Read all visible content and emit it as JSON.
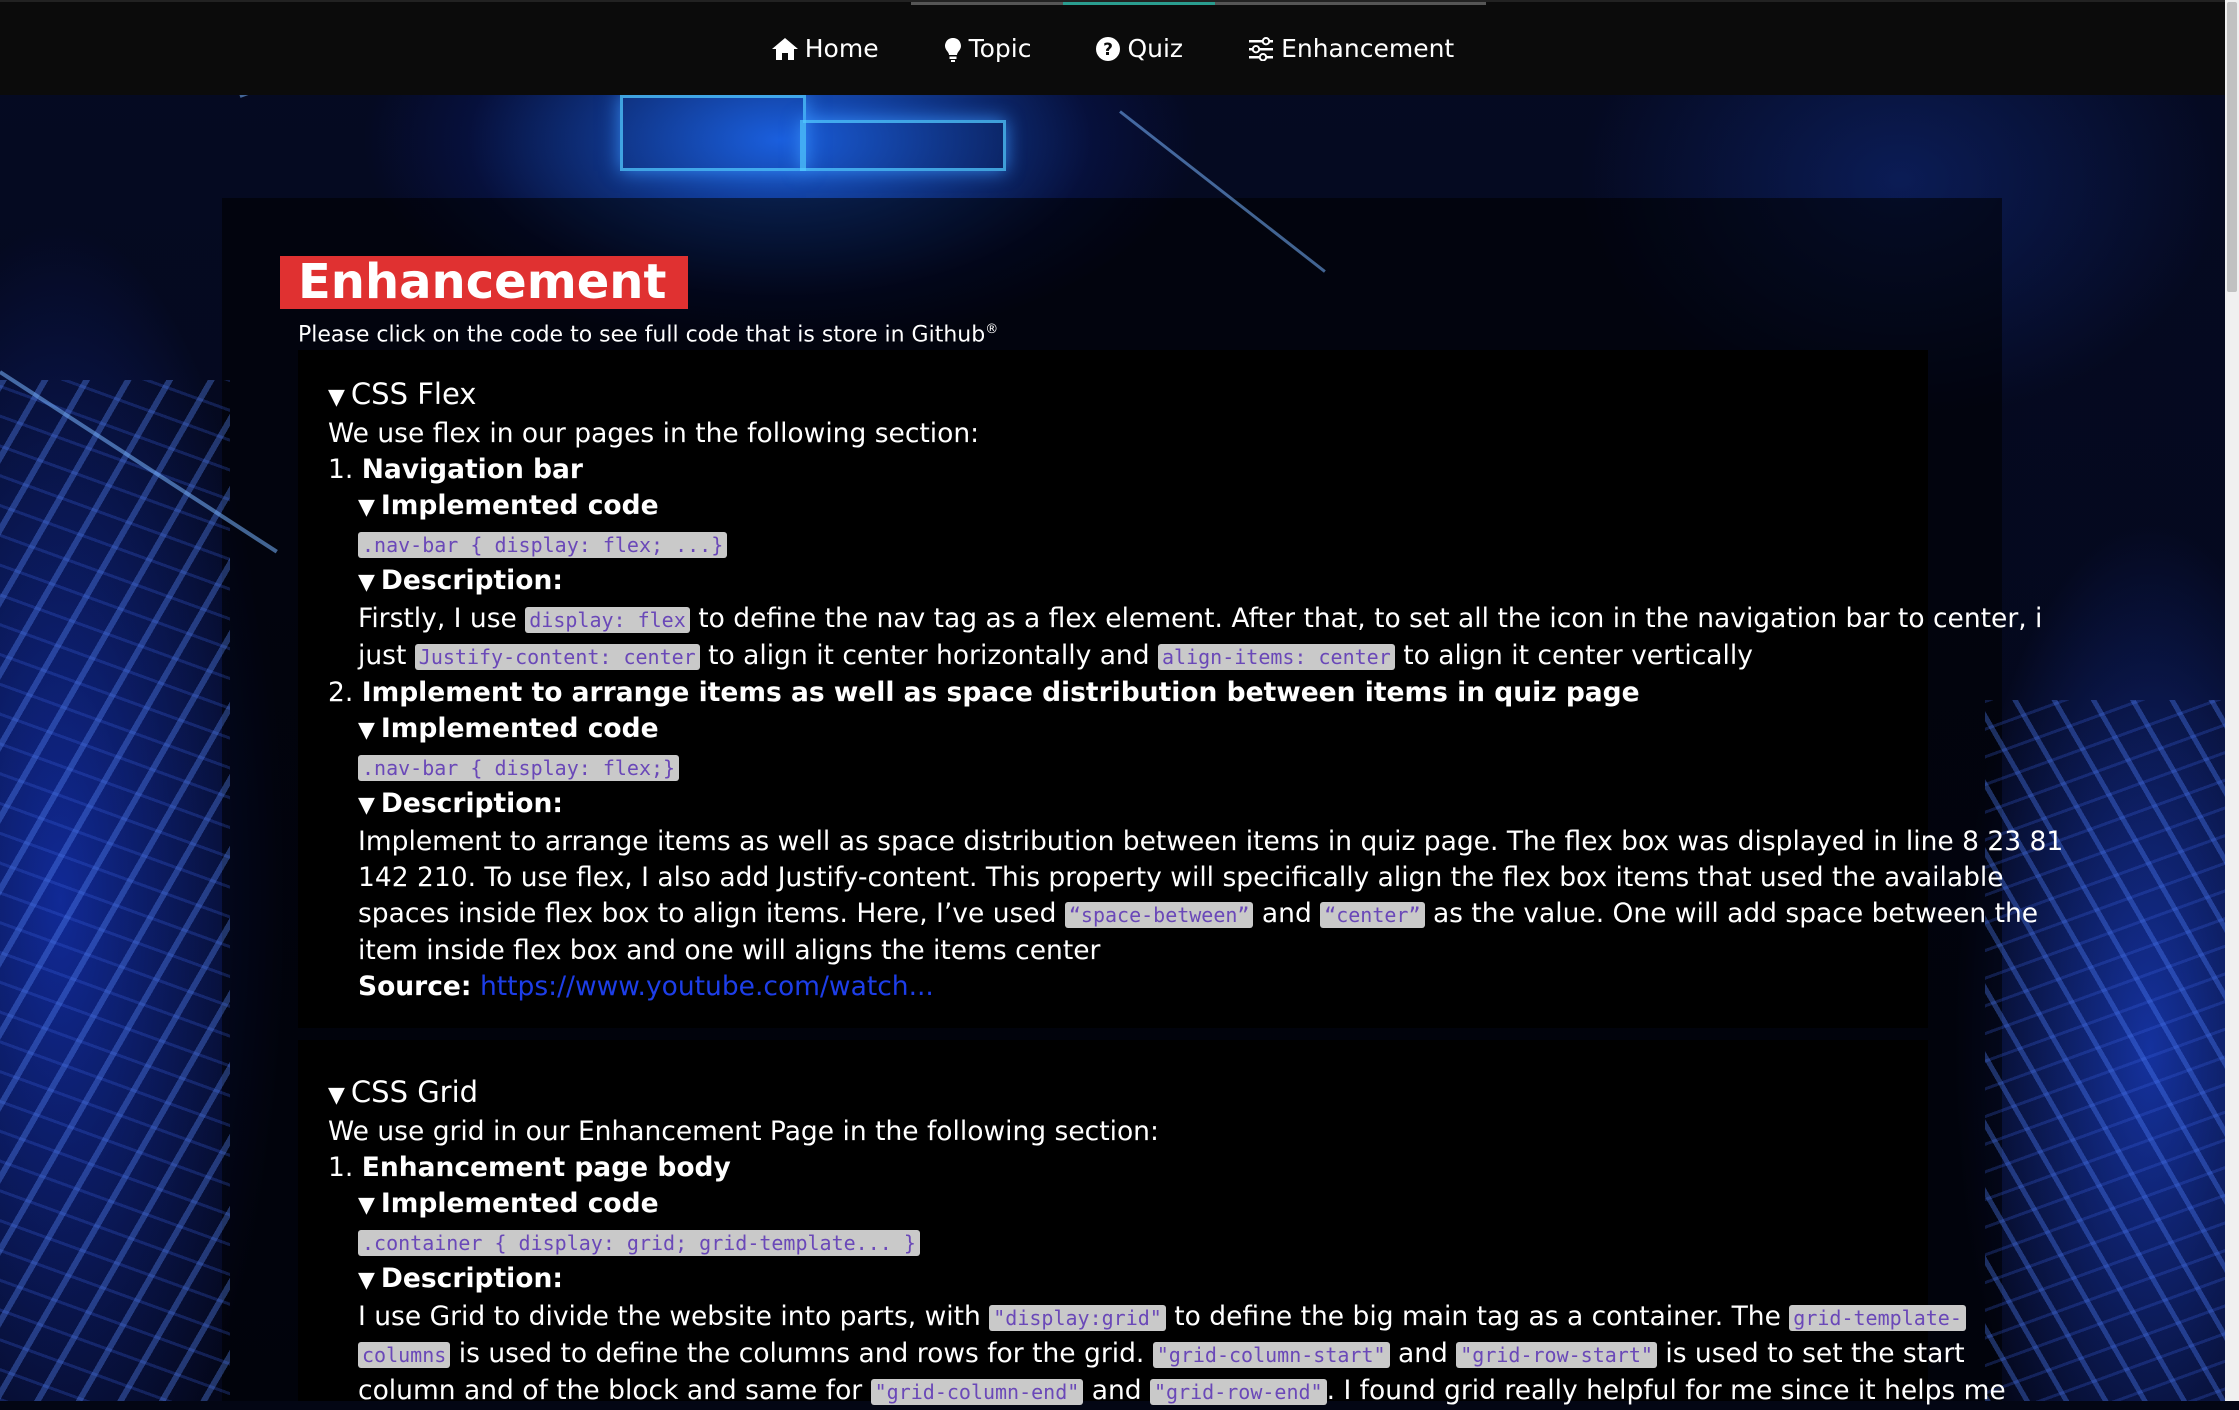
{
  "nav": {
    "items": [
      {
        "label": "Home",
        "icon": "home-icon"
      },
      {
        "label": "Topic",
        "icon": "lightbulb-icon"
      },
      {
        "label": "Quiz",
        "icon": "question-circle-icon"
      },
      {
        "label": "Enhancement",
        "icon": "sliders-icon"
      }
    ]
  },
  "page": {
    "title": "Enhancement",
    "subtitle": "Please click on the code to see full code that is store in Github",
    "subtitle_mark": "®"
  },
  "flex": {
    "summary": "CSS Flex",
    "intro": "We use flex in our pages in the following section:",
    "items": [
      {
        "num": "1.",
        "title": "Navigation bar",
        "impl_label": "Implemented code",
        "code": ".nav-bar { display: flex; ...}",
        "desc_label": "Description:",
        "desc": {
          "t1": "Firstly, I use ",
          "c1": "display: flex",
          "t2": " to define the nav tag as a flex element. After that, to set all the icon in the navigation bar to center, i",
          "t3": "just ",
          "c2": "Justify-content: center",
          "t4": " to align it center horizontally and ",
          "c3": "align-items: center",
          "t5": " to align it center vertically"
        }
      },
      {
        "num": "2.",
        "title": "Implement to arrange items as well as space distribution between items in quiz page",
        "impl_label": "Implemented code",
        "code": ".nav-bar { display: flex;}",
        "desc_label": "Description:",
        "desc": {
          "l1": "Implement to arrange items as well as space distribution between items in quiz page. The flex box was displayed in line 8 23 81",
          "l2": "142 210. To use flex, I also add Justify-content. This property will specifically align the flex box items that used the available",
          "l3a": "spaces inside flex box to align items. Here, I’ve used ",
          "c1": "“space-between”",
          "l3b": " and ",
          "c2": "“center”",
          "l3c": " as the value. One will add space between the",
          "l4": "item inside flex box and one will aligns the items center"
        },
        "source_label": "Source:",
        "source_link": "https://www.youtube.com/watch..."
      }
    ]
  },
  "grid": {
    "summary": "CSS Grid",
    "intro": "We use grid in our Enhancement Page in the following section:",
    "items": [
      {
        "num": "1.",
        "title": "Enhancement page body",
        "impl_label": "Implemented code",
        "code": ".container { display: grid; grid-template... }",
        "desc_label": "Description:",
        "desc": {
          "t1": "I use Grid to divide the website into parts, with ",
          "c1": "\"display:grid\"",
          "t2": " to define the big main tag as a container. The ",
          "c2a": "grid-template-",
          "c2b": "columns",
          "t3": " is used to define the columns and rows for the grid. ",
          "c3": "\"grid-column-start\"",
          "t4": " and ",
          "c4": "\"grid-row-start\"",
          "t5": " is used to set the start",
          "t6": "column and of the block and same for ",
          "c5": "\"grid-column-end\"",
          "t7": " and ",
          "c6": "\"grid-row-end\"",
          "t8": ". I found grid really helpful for me since it helps me"
        }
      }
    ]
  },
  "colors": {
    "nav_bg": "#0b0b0b",
    "title_badge": "#e03131",
    "code_text": "#6a48b8",
    "code_bg": "#c9c9c9",
    "link": "#1d3ee8",
    "nav_active": "#2a9d8f"
  }
}
